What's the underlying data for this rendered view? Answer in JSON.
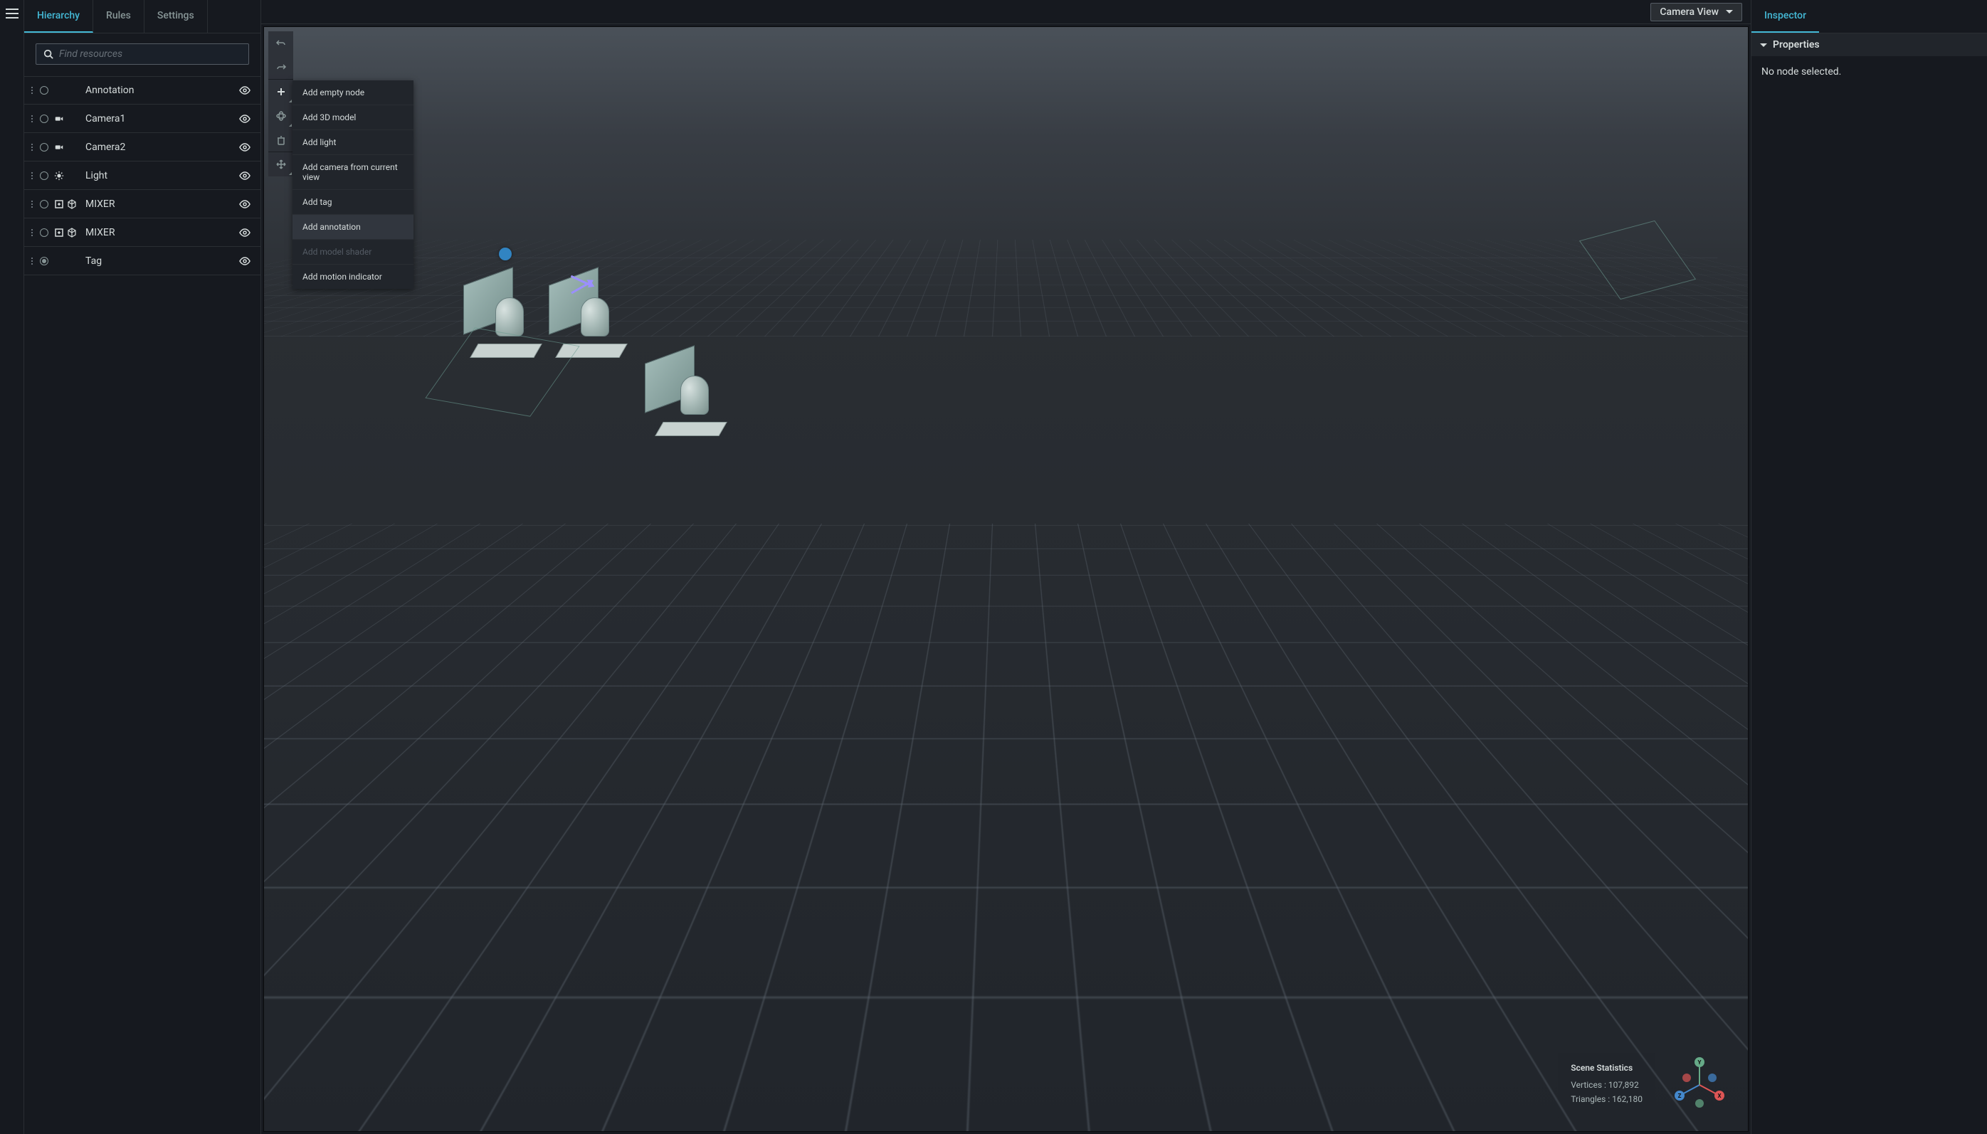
{
  "leftTabs": {
    "hierarchy": "Hierarchy",
    "rules": "Rules",
    "settings": "Settings"
  },
  "search": {
    "placeholder": "Find resources"
  },
  "tree": [
    {
      "label": "Annotation",
      "type": "annotation"
    },
    {
      "label": "Camera1",
      "type": "camera"
    },
    {
      "label": "Camera2",
      "type": "camera"
    },
    {
      "label": "Light",
      "type": "light"
    },
    {
      "label": "MIXER",
      "type": "model"
    },
    {
      "label": "MIXER",
      "type": "model"
    },
    {
      "label": "Tag",
      "type": "tag"
    }
  ],
  "cameraView": "Camera View",
  "addMenu": {
    "emptyNode": "Add empty node",
    "model3d": "Add 3D model",
    "light": "Add light",
    "cameraFromView": "Add camera from current view",
    "tag": "Add tag",
    "annotation": "Add annotation",
    "modelShader": "Add model shader",
    "motionIndicator": "Add motion indicator"
  },
  "sceneStats": {
    "title": "Scene Statistics",
    "vertices": "Vertices : 107,892",
    "triangles": "Triangles : 162,180"
  },
  "viewCube": {
    "y": "Y",
    "x": "X",
    "z": "Z"
  },
  "inspector": {
    "tab": "Inspector",
    "properties": "Properties",
    "noSelection": "No node selected."
  }
}
